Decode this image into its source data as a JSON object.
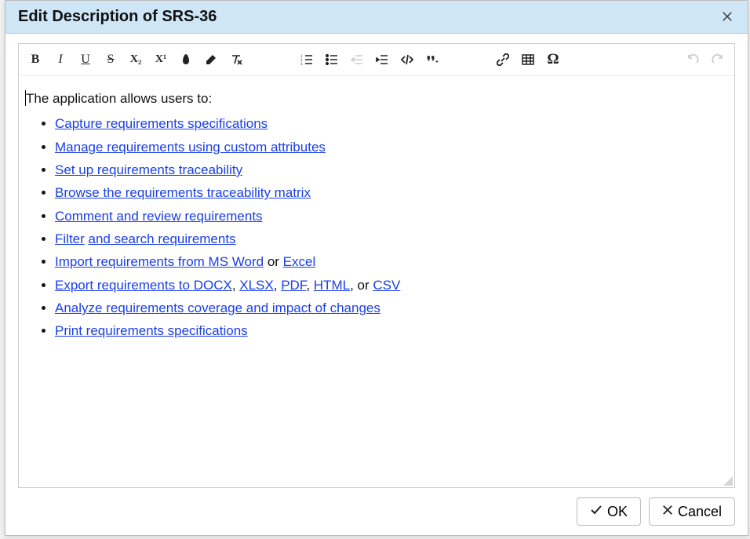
{
  "dialog": {
    "title": "Edit Description of SRS-36"
  },
  "toolbar": {
    "bold": "B",
    "italic": "I",
    "underline": "U",
    "strike": "S",
    "subscript": "X₂",
    "superscript": "X¹"
  },
  "content": {
    "intro": "The application allows users to:",
    "items": [
      {
        "parts": [
          {
            "type": "link",
            "text": "Capture requirements specifications"
          }
        ]
      },
      {
        "parts": [
          {
            "type": "link",
            "text": "Manage requirements using custom attributes"
          }
        ]
      },
      {
        "parts": [
          {
            "type": "link",
            "text": "Set up requirements traceability"
          }
        ]
      },
      {
        "parts": [
          {
            "type": "link",
            "text": "Browse the requirements traceability matrix"
          }
        ]
      },
      {
        "parts": [
          {
            "type": "link",
            "text": "Comment and review requirements"
          }
        ]
      },
      {
        "parts": [
          {
            "type": "link",
            "text": "Filter"
          },
          {
            "type": "text",
            "text": " "
          },
          {
            "type": "link",
            "text": "and search requirements"
          }
        ]
      },
      {
        "parts": [
          {
            "type": "link",
            "text": "Import requirements from MS Word"
          },
          {
            "type": "text",
            "text": " or "
          },
          {
            "type": "link",
            "text": "Excel"
          }
        ]
      },
      {
        "parts": [
          {
            "type": "link",
            "text": "Export requirements to DOCX"
          },
          {
            "type": "text",
            "text": ", "
          },
          {
            "type": "link",
            "text": "XLSX"
          },
          {
            "type": "text",
            "text": ",  "
          },
          {
            "type": "link",
            "text": "PDF"
          },
          {
            "type": "text",
            "text": ", "
          },
          {
            "type": "link",
            "text": "HTML"
          },
          {
            "type": "text",
            "text": ", or "
          },
          {
            "type": "link",
            "text": "CSV"
          }
        ]
      },
      {
        "parts": [
          {
            "type": "link",
            "text": "Analyze requirements coverage and impact of changes"
          }
        ]
      },
      {
        "parts": [
          {
            "type": "link",
            "text": "Print requirements specifications"
          }
        ]
      }
    ]
  },
  "footer": {
    "ok": "OK",
    "cancel": "Cancel"
  }
}
